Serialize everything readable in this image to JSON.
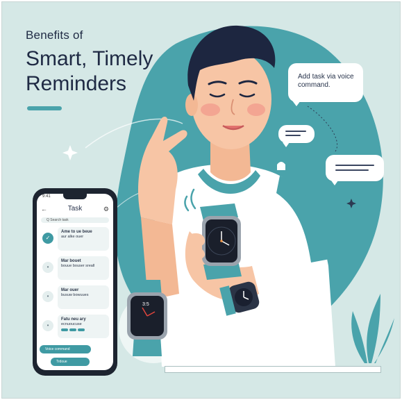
{
  "title": {
    "eyebrow": "Benefits of",
    "line1": "Smart, Timely",
    "line2": "Reminders"
  },
  "speech_bubble": {
    "text": "Add task via voice command."
  },
  "phone": {
    "status_time": "9:41",
    "header_title": "Task",
    "back_icon": "arrow-left-icon",
    "menu_icon": "settings-icon",
    "search_text": "Q Search task",
    "tasks": [
      {
        "title": "Ame to ue beue",
        "detail": "aur alke ouer"
      },
      {
        "title": "Mar bouet",
        "detail": "bouue bouser sreall"
      },
      {
        "title": "Mar ouer",
        "detail": "busuw bowuues"
      },
      {
        "title": "Fatu neu ary",
        "detail": "ecnuoucuse"
      }
    ],
    "voice_pill": "Voice command",
    "send_pill": "Trdoue"
  },
  "watch_small": {
    "time": "3:5"
  },
  "colors": {
    "background": "#d5e8e6",
    "accent": "#3f9aa3",
    "dark_text": "#1f2a44",
    "shirt": "#ffffff",
    "skin": "#f7c5a5",
    "hair": "#1d2640"
  },
  "icons": [
    "wifi-wave-icon",
    "bell-icon",
    "sparkle-icon",
    "plant-icon"
  ]
}
